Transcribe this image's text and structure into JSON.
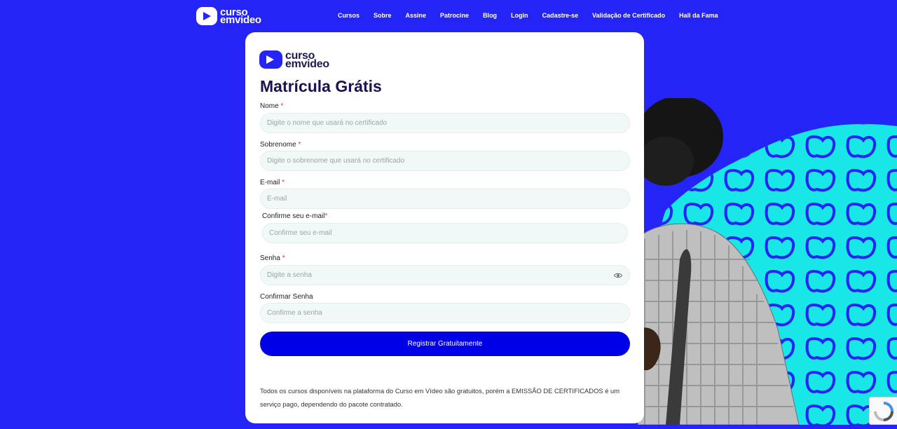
{
  "brand": {
    "line1": "curso",
    "line2": "emvideo",
    "icon": "play-icon"
  },
  "nav": {
    "items": [
      {
        "label": "Cursos"
      },
      {
        "label": "Sobre"
      },
      {
        "label": "Assine"
      },
      {
        "label": "Patrocine"
      },
      {
        "label": "Blog"
      },
      {
        "label": "Login"
      },
      {
        "label": "Cadastre-se"
      },
      {
        "label": "Validação de Certificado"
      },
      {
        "label": "Hall da Fama"
      }
    ]
  },
  "form": {
    "title": "Matrícula Grátis",
    "required_mark": "*",
    "fields": {
      "nome": {
        "label": "Nome",
        "placeholder": "Digite o nome que usará no certificado"
      },
      "sobrenome": {
        "label": "Sobrenome",
        "placeholder": "Digite o sobrenome que usará no certificado"
      },
      "email": {
        "label": "E-mail",
        "placeholder": "E-mail"
      },
      "confirm_email": {
        "label": "Confirme seu e-mail",
        "placeholder": "Confirme seu e-mail"
      },
      "senha": {
        "label": "Senha",
        "placeholder": "Digite a senha",
        "icon": "eye-icon"
      },
      "confirm_senha": {
        "label": "Confirmar Senha",
        "placeholder": "Confirme a senha"
      }
    },
    "submit_label": "Registrar Gratuitamente",
    "note": "Todos os cursos disponíveis na plataforma do Curso em Vídeo são gratuitos, porém a EMISSÃO DE CERTIFICADOS é um serviço pago, dependendo do pacote contratado."
  },
  "colors": {
    "background": "#2424f6",
    "button": "#0000e6",
    "title": "#1b1350",
    "accent_cyan": "#19e6e6"
  }
}
